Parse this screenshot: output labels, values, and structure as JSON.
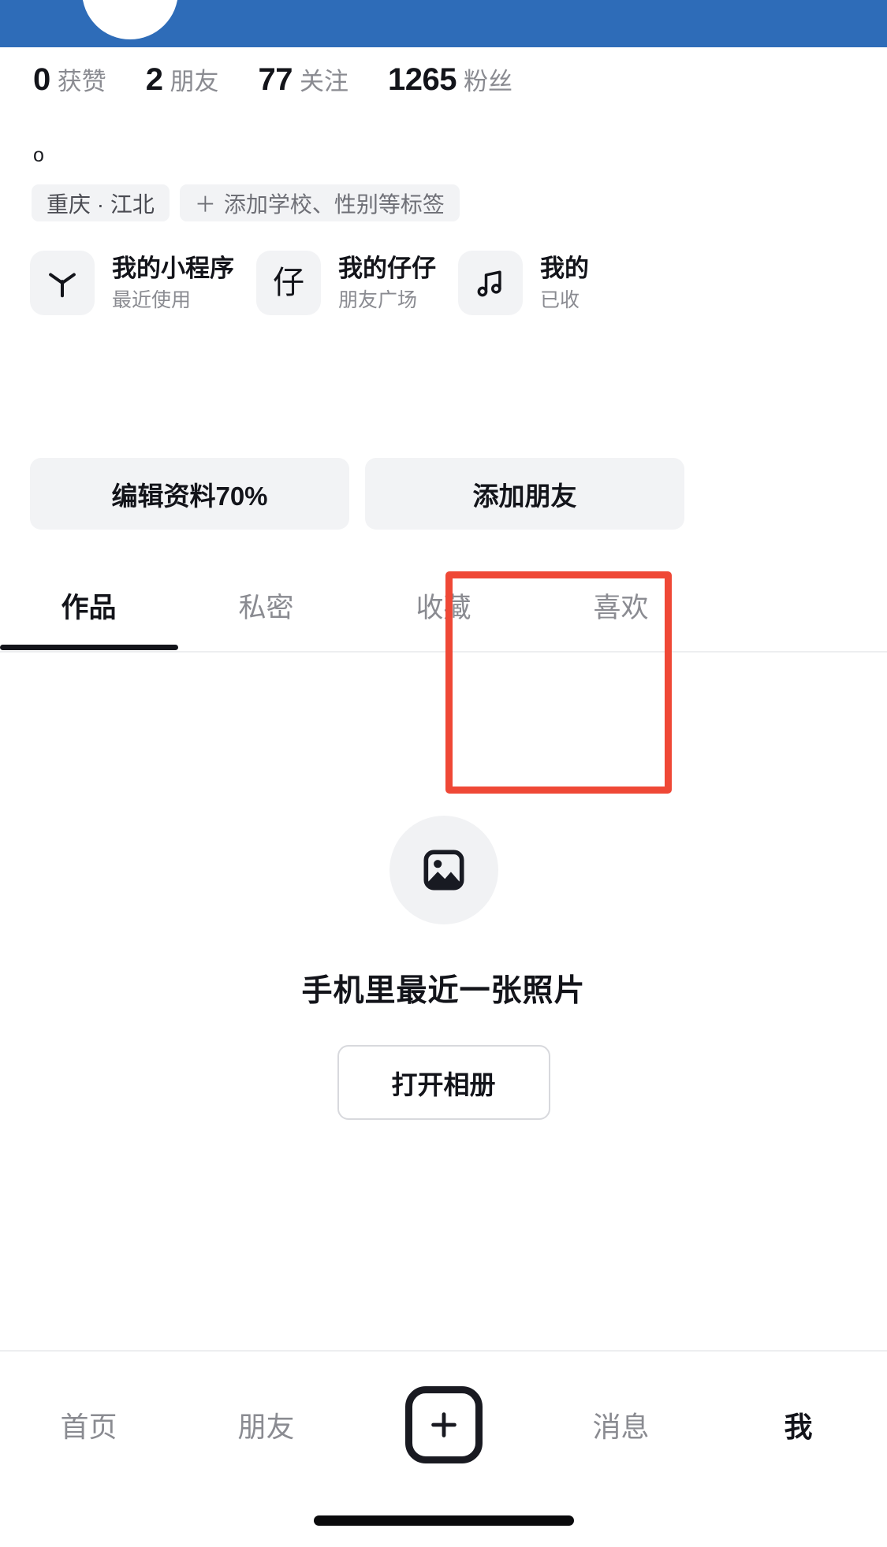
{
  "theme": {
    "header_blue": "#2E6CB8",
    "accent_red": "#EF4836",
    "text_primary": "#13141A",
    "text_secondary": "#8A8B91",
    "chip_bg": "#F2F3F5"
  },
  "stats": [
    {
      "value": "0",
      "label": "获赞"
    },
    {
      "value": "2",
      "label": "朋友"
    },
    {
      "value": "77",
      "label": "关注"
    },
    {
      "value": "1265",
      "label": "粉丝"
    }
  ],
  "bio": "o",
  "tags": [
    {
      "text": "重庆 · 江北",
      "icon": ""
    },
    {
      "text": "添加学校、性别等标签",
      "icon": "plus"
    }
  ],
  "tag_plus_glyph": "＋",
  "miniapps": [
    {
      "title": "我的小程序",
      "subtitle": "最近使用",
      "icon": "asterisk-icon"
    },
    {
      "title": "我的仔仔",
      "subtitle": "朋友广场",
      "icon": "zai-character-icon"
    },
    {
      "title": "我的",
      "subtitle": "已收",
      "icon": "music-note-icon"
    }
  ],
  "actions": [
    {
      "label": "编辑资料70%"
    },
    {
      "label": "添加朋友"
    }
  ],
  "tabs": [
    {
      "label": "作品",
      "active": true
    },
    {
      "label": "私密",
      "active": false
    },
    {
      "label": "收藏",
      "active": false
    },
    {
      "label": "喜欢",
      "active": false
    }
  ],
  "empty_state": {
    "icon": "image-icon",
    "title": "手机里最近一张照片",
    "button_label": "打开相册"
  },
  "bottom_nav": [
    {
      "label": "首页",
      "active": false
    },
    {
      "label": "朋友",
      "active": false
    },
    {
      "label": "消息",
      "active": false
    },
    {
      "label": "我",
      "active": true
    }
  ],
  "bottom_nav_plus": "plus-icon"
}
